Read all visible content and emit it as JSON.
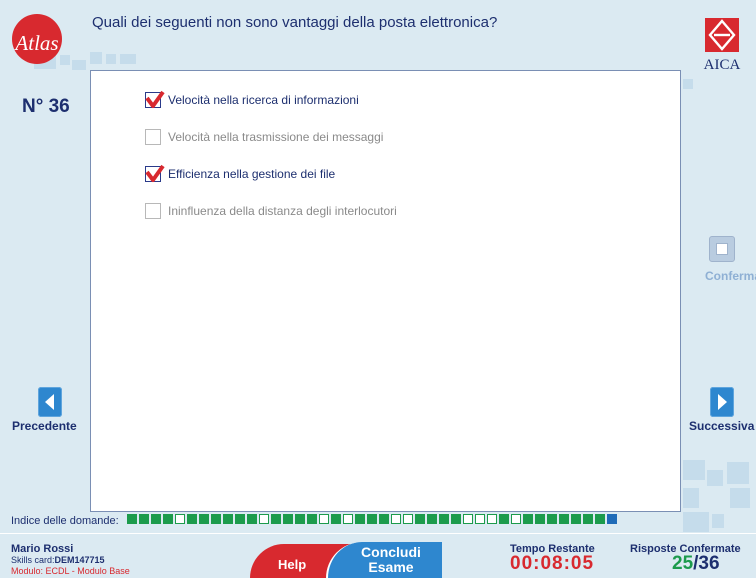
{
  "header": {
    "question_text": "Quali dei seguenti non sono vantaggi della posta elettronica?",
    "atlas_logo_text": "Atlas",
    "aica_logo_text": "AICA"
  },
  "question_number": "N° 36",
  "options": [
    {
      "label": "Velocità nella ricerca di informazioni",
      "checked": true,
      "enabled": true
    },
    {
      "label": "Velocità nella trasmissione dei messaggi",
      "checked": false,
      "enabled": false
    },
    {
      "label": "Efficienza nella gestione dei file",
      "checked": true,
      "enabled": true
    },
    {
      "label": "Ininfluenza della distanza degli interlocutori",
      "checked": false,
      "enabled": false
    }
  ],
  "confirm_label": "Conferma",
  "nav": {
    "prev_label": "Precedente",
    "next_label": "Successiva"
  },
  "index": {
    "label": "Indice delle domande:",
    "squares": [
      "answered",
      "answered",
      "answered",
      "answered",
      "empty",
      "answered",
      "answered",
      "answered",
      "answered",
      "answered",
      "answered",
      "empty",
      "answered",
      "answered",
      "answered",
      "answered",
      "empty",
      "answered",
      "empty",
      "answered",
      "answered",
      "answered",
      "empty",
      "empty",
      "answered",
      "answered",
      "answered",
      "answered",
      "empty",
      "empty",
      "empty",
      "answered",
      "empty",
      "answered",
      "answered",
      "answered",
      "answered",
      "answered",
      "answered",
      "answered",
      "current"
    ]
  },
  "footer": {
    "user_name": "Mario Rossi",
    "skills_card_label": "Skills card:",
    "skills_card_value": "DEM147715",
    "modulo_text": "Modulo: ECDL - Modulo Base",
    "help_label": "Help",
    "concludi_label": "Concludi Esame",
    "timer_label": "Tempo Restante",
    "timer_value": "00:08:05",
    "answers_label": "Risposte Confermate",
    "answers_done": "25",
    "answers_sep": "/",
    "answers_total": "36"
  },
  "colors": {
    "brand_red": "#d8292f",
    "navy": "#1d2f6f",
    "green": "#1c9b4c",
    "blue": "#2e87cf",
    "background": "#dbeaf2"
  }
}
